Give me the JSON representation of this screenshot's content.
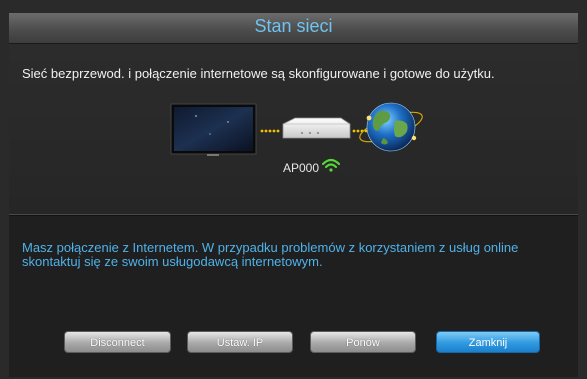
{
  "dialog": {
    "title": "Stan sieci",
    "status_message": "Sieć bezprzewod. i połączenie internetowe są skonfigurowane i gotowe do użytku.",
    "ap_name": "AP000",
    "info_message": "Masz połączenie z Internetem. W przypadku problemów z korzystaniem z usług online skontaktuj się ze swoim usługodawcą internetowym."
  },
  "buttons": {
    "disconnect": "Disconnect",
    "ip_settings": "Ustaw. IP",
    "retry": "Ponów",
    "close": "Zamknij"
  },
  "colors": {
    "title": "#6fc3f0",
    "info_text": "#4fb2ea",
    "link_dots": "#f2c200",
    "wifi": "#55d63a",
    "focused_button": "#2f9ae0"
  },
  "icons": {
    "tv": "tv-icon",
    "router": "router-icon",
    "internet": "globe-icon",
    "signal": "wifi-icon"
  }
}
